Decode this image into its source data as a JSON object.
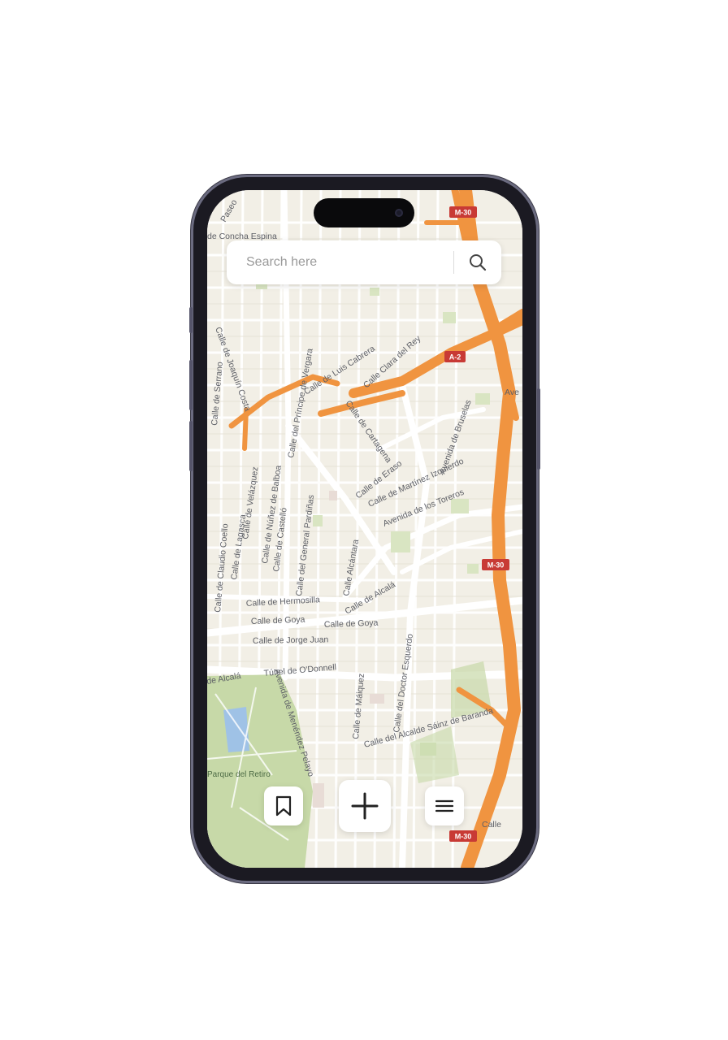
{
  "search": {
    "placeholder": "Search here",
    "button_icon": "search-icon"
  },
  "map": {
    "street_labels": [
      "de Concha Espina",
      "Calle de Luis Cabrera",
      "Calle Clara del Rey",
      "Calle del Príncipe de Vergara",
      "Calle de Cartagena",
      "Calle de Eraso",
      "Calle de Martínez Izquierdo",
      "Avenida de Bruselas",
      "Avenida de los Toreros",
      "Calle de Claudio Coello",
      "Calle de Lagasca",
      "Calle de Velázquez",
      "Calle de Núñez de Balboa",
      "Calle de Castelló",
      "Calle del General Pardiñas",
      "Calle Alcántara",
      "Calle de Hermosilla",
      "Calle de Alcalá",
      "Calle de Goya",
      "Calle de Jorge Juan",
      "Túnel de O'Donnell",
      "de Alcalá",
      "Calle de Máiquez",
      "Calle del Doctor Esquerdo",
      "Calle del Alcalde Sáinz de Baranda",
      "Avenida de Menéndez Pelayo",
      "Parque del Retiro",
      "Calle de Serrano",
      "Calle de Joaquín Costa",
      "Ave",
      "Calle",
      "Paseo"
    ],
    "road_shields": [
      "M-30",
      "A-2",
      "M-30",
      "M-30"
    ]
  },
  "bottom_bar": {
    "bookmark_icon": "bookmark-icon",
    "add_icon": "plus-icon",
    "menu_icon": "menu-icon"
  },
  "colors": {
    "map_background": "#f2efe6",
    "highway": "#f09440",
    "park": "#c7d9a8",
    "road_shield": "#c83a35"
  }
}
